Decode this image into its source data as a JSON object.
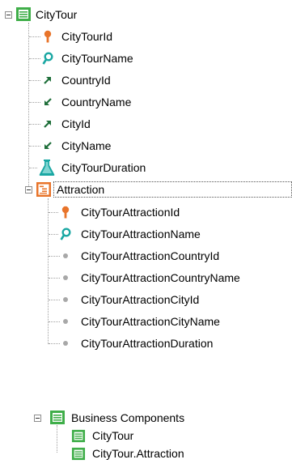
{
  "tree": {
    "root": {
      "label": "CityTour",
      "icon": "transaction-icon",
      "attributes": [
        {
          "label": "CityTourId",
          "icon": "key-icon"
        },
        {
          "label": "CityTourName",
          "icon": "search-icon"
        },
        {
          "label": "CountryId",
          "icon": "arrow-up-right-icon"
        },
        {
          "label": "CountryName",
          "icon": "arrow-down-left-icon"
        },
        {
          "label": "CityId",
          "icon": "arrow-up-right-icon"
        },
        {
          "label": "CityName",
          "icon": "arrow-down-left-icon"
        },
        {
          "label": "CityTourDuration",
          "icon": "flask-icon"
        }
      ],
      "level": {
        "label": "Attraction",
        "icon": "level-icon",
        "attributes": [
          {
            "label": "CityTourAttractionId",
            "icon": "key-icon"
          },
          {
            "label": "CityTourAttractionName",
            "icon": "search-icon"
          },
          {
            "label": "CityTourAttractionCountryId",
            "icon": "dot-icon"
          },
          {
            "label": "CityTourAttractionCountryName",
            "icon": "dot-icon"
          },
          {
            "label": "CityTourAttractionCityId",
            "icon": "dot-icon"
          },
          {
            "label": "CityTourAttractionCityName",
            "icon": "dot-icon"
          },
          {
            "label": "CityTourAttractionDuration",
            "icon": "dot-icon"
          }
        ]
      }
    }
  },
  "business_components": {
    "label": "Business Components",
    "items": [
      {
        "label": "CityTour"
      },
      {
        "label": "CityTour.Attraction"
      }
    ]
  },
  "colors": {
    "green": "#3fae49",
    "orange": "#e8742a",
    "teal": "#1aa7a3",
    "arrow_green": "#1f6f3a",
    "dot": "#a8a8a8"
  }
}
